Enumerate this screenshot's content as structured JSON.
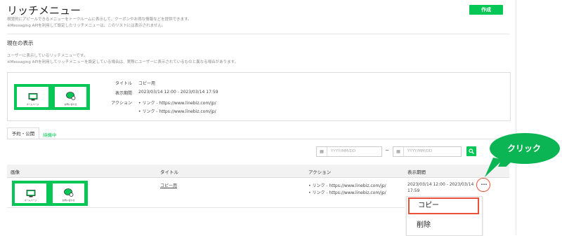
{
  "header": {
    "title": "リッチメニュー",
    "create_label": "作成"
  },
  "description": {
    "line1": "視覚的にアピールできるメニューをトークルームに表示して、クーポンやお得な情報などを提供できます。",
    "line2": "※Messaging APIを利用して設定したリッチメニューは、このリストには表示されません。"
  },
  "current": {
    "heading": "現在の表示",
    "note1": "ユーザーに表示しているリッチメニューです。",
    "note2": "※Messaging APIを利用してリッチメニューを設定している場合は、実際にユーザーに表示されているものと異なる場合があります。",
    "thumb": {
      "tile1_label": "ホームページ",
      "tile2_label": "お問い合わせ"
    },
    "title_key": "タイトル",
    "title_value": "コピー用",
    "period_key": "表示期間",
    "period_value": "2023/03/14 12:00 - 2023/03/14 17:59",
    "action_key": "アクション",
    "actions": [
      "• リンク - https://www.linebiz.com/jp/",
      "• リンク - https://www.linebiz.com/jp/"
    ]
  },
  "tabs": [
    {
      "label": "予約・公開",
      "active": true
    },
    {
      "label": "待機中",
      "active": false
    }
  ],
  "filter": {
    "start_placeholder": "YYYY/MM/DD",
    "separator": "~",
    "end_placeholder": "YYYY/MM/DD"
  },
  "table": {
    "headers": [
      "画像",
      "タイトル",
      "アクション",
      "表示期間"
    ],
    "rows": [
      {
        "thumb": {
          "tile1_label": "ホームページ",
          "tile2_label": "お問い合わせ"
        },
        "title": "コピー用",
        "actions": [
          "• リンク - https://www.linebiz.com/jp/",
          "• リンク - https://www.linebiz.com/jp/"
        ],
        "period_line1": "2023/03/14 12:00 - 2023/03/14",
        "period_line2": "17:59",
        "more_label": "···"
      }
    ]
  },
  "context_menu": {
    "copy_label": "コピー",
    "delete_label": "削除"
  },
  "callout": {
    "text": "クリック"
  },
  "colors": {
    "brand_green": "#06c755",
    "highlight_red": "#e8523a",
    "callout_green": "#0bb553"
  }
}
